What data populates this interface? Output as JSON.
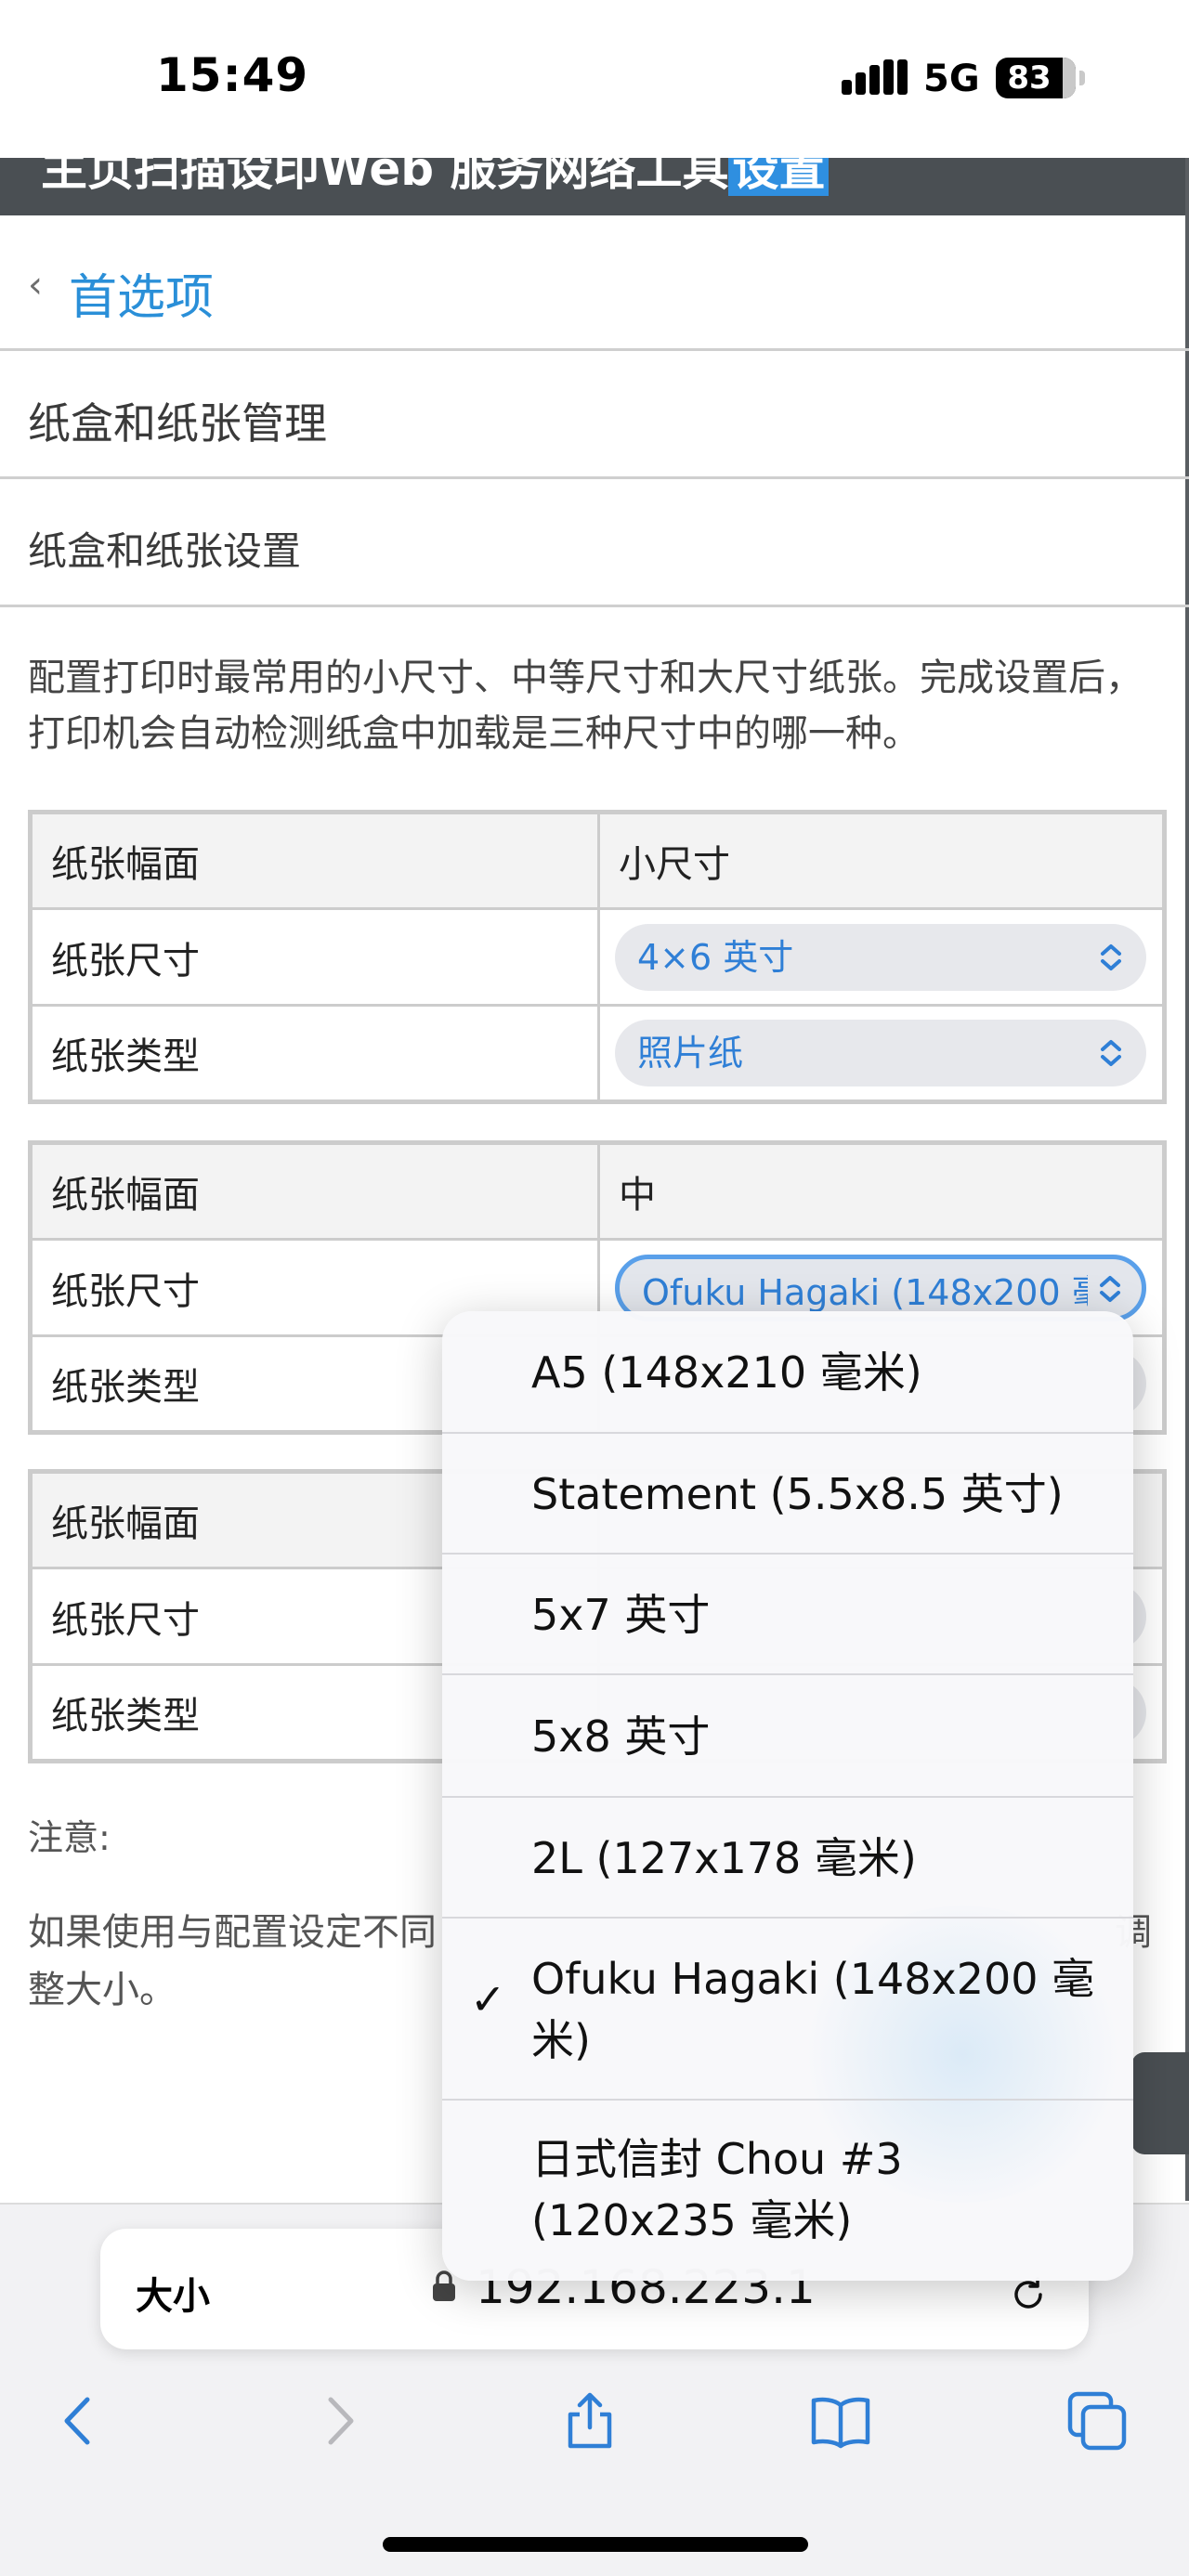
{
  "status_bar": {
    "time": "15:49",
    "network": "5G",
    "battery": "83"
  },
  "header": {
    "partial_text": "主页扫描设印Web 服务网络工具",
    "partial_link": "设置"
  },
  "nav": {
    "back_label": "首选项"
  },
  "sections": {
    "tray_management": "纸盒和纸张管理",
    "tray_settings": "纸盒和纸张设置"
  },
  "description": "配置打印时最常用的小尺寸、中等尺寸和大尺寸纸张。完成设置后，打印机会自动检测纸盒中加载是三种尺寸中的哪一种。",
  "tables": [
    {
      "format_label": "纸张幅面",
      "format_value": "小尺寸",
      "size_label": "纸张尺寸",
      "size_value": "4×6 英寸",
      "type_label": "纸张类型",
      "type_value": "照片纸"
    },
    {
      "format_label": "纸张幅面",
      "format_value": "中",
      "size_label": "纸张尺寸",
      "size_value": "Ofuku Hagaki (148x200 毫米)",
      "type_label": "纸张类型",
      "type_value": ""
    },
    {
      "format_label": "纸张幅面",
      "format_value": "",
      "size_label": "纸张尺寸",
      "size_value": "",
      "type_label": "纸张类型",
      "type_value": ""
    }
  ],
  "note": {
    "label": "注意:",
    "text_start": "如果使用与配置设定不同",
    "text_end": "调",
    "text_second_line": "整大小。"
  },
  "dropdown": {
    "selected": "Ofuku Hagaki (148x200 毫米)",
    "options": [
      "A5 (148x210 毫米)",
      "Statement (5.5x8.5 英寸)",
      "5x7 英寸",
      "5x8 英寸",
      "2L (127x178 毫米)",
      "Ofuku Hagaki (148x200 毫米)",
      "日式信封 Chou #3 (120x235 毫米)"
    ]
  },
  "safari": {
    "aa_label": "大小",
    "url": "192.168.223.1"
  },
  "icons": [
    "back-icon",
    "forward-icon",
    "share-icon",
    "bookmarks-icon",
    "tabs-icon",
    "lock-icon",
    "reload-icon",
    "chevron-updown-icon",
    "checkmark-icon"
  ],
  "colors": {
    "link": "#2a8fd8",
    "accent": "#2f7fd6",
    "header_bg": "#4a4f53"
  }
}
